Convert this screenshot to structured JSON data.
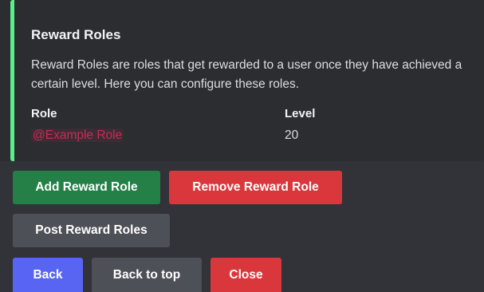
{
  "embed": {
    "accent_color": "#57f287",
    "title": "Reward Roles",
    "description": "Reward Roles are roles that get rewarded to a user once they have achieved a certain level. Here you can configure these roles.",
    "fields": [
      {
        "name": "Role",
        "value": "@Example Role",
        "value_color": "#c82b56"
      },
      {
        "name": "Level",
        "value": "20"
      }
    ]
  },
  "buttons": {
    "row1": [
      {
        "label": "Add Reward Role",
        "style": "success",
        "color": "#248046"
      },
      {
        "label": "Remove Reward Role",
        "style": "danger",
        "color": "#da373c"
      }
    ],
    "row2": [
      {
        "label": "Post Reward Roles",
        "style": "secondary",
        "color": "#4e5058"
      }
    ],
    "row3": [
      {
        "label": "Back",
        "style": "primary",
        "color": "#5865f2"
      },
      {
        "label": "Back to top",
        "style": "secondary",
        "color": "#4e5058"
      },
      {
        "label": "Close",
        "style": "danger",
        "color": "#da373c"
      }
    ]
  }
}
